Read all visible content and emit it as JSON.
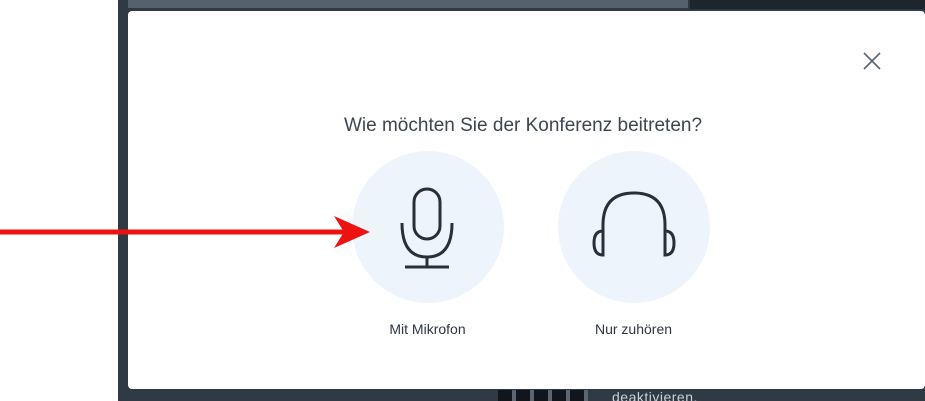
{
  "dialog": {
    "title": "Wie möchten Sie der Konferenz beitreten?",
    "close_icon": "close-icon",
    "options": [
      {
        "label": "Mit Mikrofon",
        "icon": "microphone-icon"
      },
      {
        "label": "Nur zuhören",
        "icon": "headphones-icon"
      }
    ]
  },
  "background": {
    "bottom_right_text": "deaktivieren."
  },
  "annotation": {
    "arrow_color": "#ee1111"
  },
  "colors": {
    "option_circle": "#eef4fb",
    "icon_stroke": "#25303a",
    "title_text": "#3c4650"
  }
}
